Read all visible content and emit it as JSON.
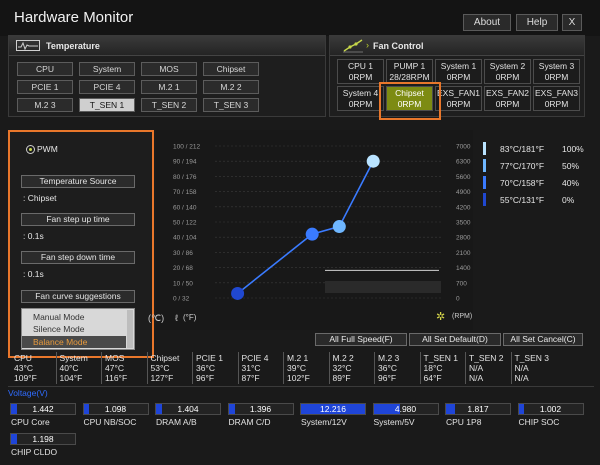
{
  "app": {
    "title": "Hardware Monitor",
    "about": "About",
    "help": "Help",
    "close": "X"
  },
  "temperature": {
    "title": "Temperature",
    "sources": [
      "CPU",
      "System",
      "MOS",
      "Chipset",
      "PCIE 1",
      "PCIE 4",
      "M.2 1",
      "M.2 2",
      "M.2 3",
      "T_SEN 1",
      "T_SEN 2",
      "T_SEN 3"
    ],
    "selected": "T_SEN 1"
  },
  "fan_control": {
    "title": "Fan Control",
    "fans": [
      {
        "name": "CPU 1",
        "rpm": "0RPM"
      },
      {
        "name": "PUMP 1",
        "rpm": "28/28RPM"
      },
      {
        "name": "System 1",
        "rpm": "0RPM"
      },
      {
        "name": "System 2",
        "rpm": "0RPM"
      },
      {
        "name": "System 3",
        "rpm": "0RPM"
      },
      {
        "name": "System 4",
        "rpm": "0RPM"
      },
      {
        "name": "Chipset",
        "rpm": "0RPM"
      },
      {
        "name": "EXS_FAN1",
        "rpm": "0RPM"
      },
      {
        "name": "EXS_FAN2",
        "rpm": "0RPM"
      },
      {
        "name": "EXS_FAN3",
        "rpm": "0RPM"
      }
    ],
    "selected": "Chipset"
  },
  "mode_panel": {
    "pwm_label": "PWM",
    "temp_source_btn": "Temperature Source",
    "temp_source_value": ": Chipset",
    "step_up_btn": "Fan step up time",
    "step_up_value": ": 0.1s",
    "step_down_btn": "Fan step down time",
    "step_down_value": ": 0.1s",
    "suggestions_btn": "Fan curve suggestions",
    "suggestions": [
      "Manual Mode",
      "Silence Mode",
      "Balance Mode"
    ],
    "suggestion_selected": "Balance Mode"
  },
  "chart_data": {
    "type": "line",
    "left_axis_ticks": [
      "100 / 212",
      "90 / 194",
      "80 / 176",
      "70 / 158",
      "60 / 140",
      "50 / 122",
      "40 / 104",
      "30 /  86",
      "20 /  68",
      "10 /  50",
      "0 /  32"
    ],
    "right_axis_ticks": [
      "7000",
      "6300",
      "5600",
      "4900",
      "4200",
      "3500",
      "2800",
      "2100",
      "1400",
      "700",
      "0"
    ],
    "left_unit_c": "(℃)",
    "left_unit_f": "(°F)",
    "right_unit": "(RPM)",
    "xlim": [
      0,
      100
    ],
    "ylim_left": [
      0,
      100
    ],
    "ylim_right": [
      0,
      7000
    ],
    "curve": [
      {
        "x": 0,
        "y": 0
      },
      {
        "x": 10,
        "y": 3
      },
      {
        "x": 33,
        "y": 7
      },
      {
        "x": 43,
        "y": 42
      },
      {
        "x": 55,
        "y": 47
      },
      {
        "x": 70,
        "y": 55
      },
      {
        "x": 100,
        "y": 90
      }
    ],
    "points": [
      {
        "x": 10,
        "y": 3
      },
      {
        "x": 43,
        "y": 42
      },
      {
        "x": 55,
        "y": 47
      },
      {
        "x": 70,
        "y": 90
      }
    ],
    "legend": [
      {
        "temp": "83°C/181°F",
        "pct": "100%",
        "color": "#b9e3ff"
      },
      {
        "temp": "77°C/170°F",
        "pct": "50%",
        "color": "#6fb7ff"
      },
      {
        "temp": "70°C/158°F",
        "pct": "40%",
        "color": "#3a7bff"
      },
      {
        "temp": "55°C/131°F",
        "pct": "0%",
        "color": "#2048d0"
      }
    ]
  },
  "actions": {
    "full_speed": "All Full Speed(F)",
    "set_default": "All Set Default(D)",
    "set_cancel": "All Set Cancel(C)"
  },
  "sensors": [
    {
      "name": "CPU",
      "c": "43°C",
      "f": "109°F"
    },
    {
      "name": "System",
      "c": "40°C",
      "f": "104°F"
    },
    {
      "name": "MOS",
      "c": "47°C",
      "f": "116°F"
    },
    {
      "name": "Chipset",
      "c": "53°C",
      "f": "127°F"
    },
    {
      "name": "PCIE 1",
      "c": "36°C",
      "f": "96°F"
    },
    {
      "name": "PCIE 4",
      "c": "31°C",
      "f": "87°F"
    },
    {
      "name": "M.2 1",
      "c": "39°C",
      "f": "102°F"
    },
    {
      "name": "M.2 2",
      "c": "32°C",
      "f": "89°F"
    },
    {
      "name": "M.2 3",
      "c": "36°C",
      "f": "96°F"
    },
    {
      "name": "T_SEN 1",
      "c": "18°C",
      "f": "64°F"
    },
    {
      "name": "T_SEN 2",
      "c": "N/A",
      "f": "N/A"
    },
    {
      "name": "T_SEN 3",
      "c": "N/A",
      "f": "N/A"
    }
  ],
  "voltage": {
    "title": "Voltage(V)",
    "items": [
      {
        "label": "CPU Core",
        "value": "1.442",
        "fill": 0.1
      },
      {
        "label": "CPU NB/SOC",
        "value": "1.098",
        "fill": 0.08
      },
      {
        "label": "DRAM A/B",
        "value": "1.404",
        "fill": 0.1
      },
      {
        "label": "DRAM C/D",
        "value": "1.396",
        "fill": 0.1
      },
      {
        "label": "System/12V",
        "value": "12.216",
        "fill": 1.0
      },
      {
        "label": "System/5V",
        "value": "4.980",
        "fill": 0.42
      },
      {
        "label": "CPU 1P8",
        "value": "1.817",
        "fill": 0.14
      },
      {
        "label": "CHIP SOC",
        "value": "1.002",
        "fill": 0.07
      },
      {
        "label": "CHIP CLDO",
        "value": "1.198",
        "fill": 0.09
      }
    ]
  }
}
